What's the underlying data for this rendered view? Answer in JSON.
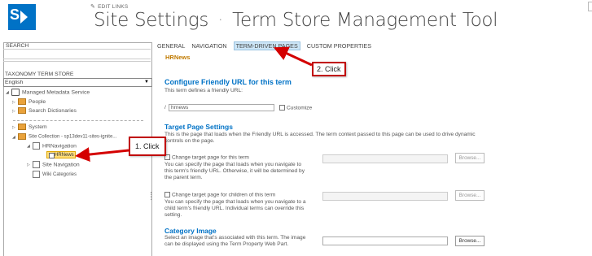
{
  "header": {
    "logo_letter": "S",
    "edit_links": "EDIT LINKS",
    "title": "Site Settings",
    "title_sep": "·",
    "subtitle": "Term Store Management Tool"
  },
  "left": {
    "search_label": "SEARCH",
    "taxonomy_label": "TAXONOMY TERM STORE",
    "language": "English",
    "tree": {
      "managed_metadata": "Managed Metadata Service",
      "people": "People",
      "search_dictionaries": "Search Dictionaries",
      "system": "System",
      "site_collection": "Site Collection - sp13dev11-sites-ignite...",
      "hrnavigation": "HRNavigation",
      "hrnews": "HRNews",
      "site_navigation": "Site Navigation",
      "wiki_categories": "Wiki Categories"
    }
  },
  "tabs": [
    "GENERAL",
    "NAVIGATION",
    "TERM-DRIVEN PAGES",
    "CUSTOM PROPERTIES"
  ],
  "active_tab": "TERM-DRIVEN PAGES",
  "main": {
    "term_name": "HRNews",
    "friendly_url": {
      "heading": "Configure Friendly URL for this term",
      "desc": "This term defines a friendly URL:",
      "prefix": "/",
      "value": "hrnews",
      "customize_label": "Customize"
    },
    "target_page": {
      "heading": "Target Page Settings",
      "desc_line1": "This is the page that loads when the Friendly URL is accessed. The term context passed to this page can be used to drive dynamic",
      "desc_line2": "controls on the page.",
      "change_label": "Change target page for this term",
      "change_desc": "You can specify the page that loads when you navigate to this term's friendly URL. Otherwise, it will be determined by the parent term.",
      "children_label": "Change target page for children of this term",
      "children_desc": "You can specify the page that loads when you navigate to a child term's friendly URL. Individual terms can override this setting.",
      "browse_label": "Browse..."
    },
    "category_image": {
      "heading": "Category Image",
      "desc": "Select an image that's associated with this term. The image can be displayed using the Term Property Web Part.",
      "browse_label": "Browse..."
    }
  },
  "callouts": {
    "step1": "1. Click",
    "step2": "2. Click"
  },
  "colors": {
    "brand": "#0072c6",
    "callout_border": "#c00000",
    "arrow": "#d40000",
    "selected_term_bg": "#ffde7a",
    "term_label": "#c07a00"
  },
  "icons": [
    "logo-icon",
    "pencil-icon",
    "managed-metadata-icon",
    "folder-icon",
    "document-icon",
    "expand-triangle-icon",
    "chevron-down-icon",
    "checkbox-icon"
  ]
}
